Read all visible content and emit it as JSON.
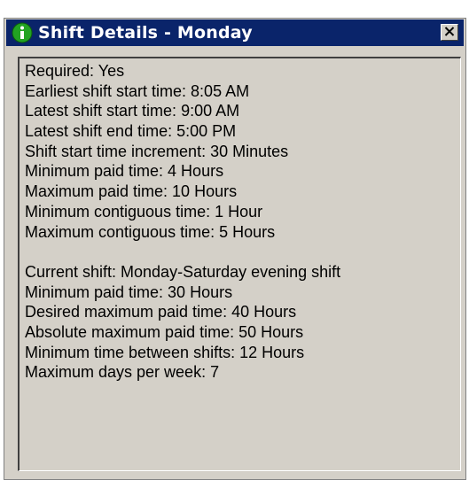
{
  "window": {
    "title": "Shift Details - Monday",
    "title_icon": "info-icon",
    "close_icon": "close-icon"
  },
  "requirements": [
    "Required: Yes",
    "Earliest shift start time: 8:05 AM",
    "Latest shift start time: 9:00 AM",
    "Latest shift end time: 5:00 PM",
    "Shift start time increment: 30 Minutes",
    "Minimum paid time: 4 Hours",
    "Maximum paid time: 10 Hours",
    "Minimum contiguous time: 1 Hour",
    "Maximum contiguous time: 5 Hours"
  ],
  "shift": [
    "Current shift: Monday-Saturday evening shift",
    "Minimum paid time: 30 Hours",
    "Desired maximum paid time: 40 Hours",
    "Absolute maximum paid time: 50 Hours",
    "Minimum time between shifts: 12 Hours",
    "Maximum days per week: 7"
  ],
  "colors": {
    "titlebar": "#0a246a",
    "window_face": "#d4d0c8",
    "info_icon": "#22a322"
  }
}
